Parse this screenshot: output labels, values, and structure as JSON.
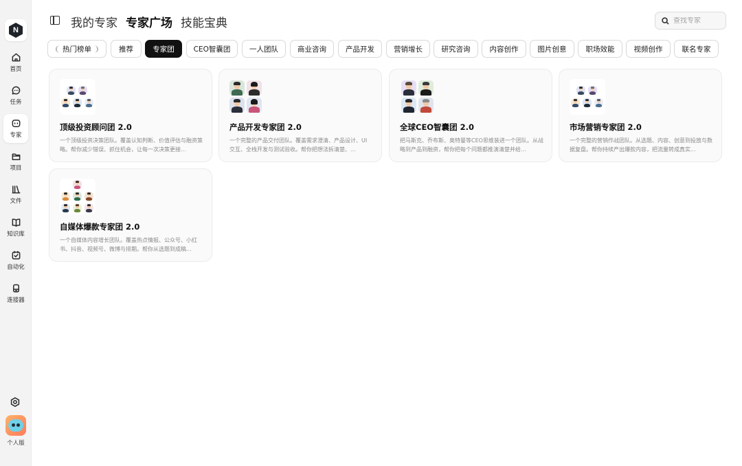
{
  "sidebar": {
    "logo_letter": "N",
    "items": [
      {
        "label": "首页",
        "icon": "home-icon"
      },
      {
        "label": "任务",
        "icon": "chat-icon"
      },
      {
        "label": "专家",
        "icon": "expert-icon",
        "active": true
      },
      {
        "label": "项目",
        "icon": "folder-icon"
      },
      {
        "label": "文件",
        "icon": "library-icon"
      },
      {
        "label": "知识库",
        "icon": "book-icon"
      },
      {
        "label": "自动化",
        "icon": "automation-icon"
      },
      {
        "label": "连接器",
        "icon": "connector-icon"
      }
    ],
    "settings_icon": "settings-icon",
    "plan_label": "个人版"
  },
  "header": {
    "tabs": [
      {
        "label": "我的专家",
        "active": false
      },
      {
        "label": "专家广场",
        "active": true
      },
      {
        "label": "技能宝典",
        "active": false
      }
    ],
    "search_placeholder": "查找专家"
  },
  "filters": [
    {
      "label": "热门榜单",
      "laurel": true
    },
    {
      "label": "推荐"
    },
    {
      "label": "专家团",
      "active": true
    },
    {
      "label": "CEO智囊团"
    },
    {
      "label": "一人团队"
    },
    {
      "label": "商业咨询"
    },
    {
      "label": "产品开发"
    },
    {
      "label": "营销增长"
    },
    {
      "label": "研究咨询"
    },
    {
      "label": "内容创作"
    },
    {
      "label": "图片创意"
    },
    {
      "label": "职场效能"
    },
    {
      "label": "视频创作"
    },
    {
      "label": "联名专家"
    }
  ],
  "cards": [
    {
      "title": "顶级投资顾问团 2.0",
      "desc": "一个顶级投资决策团队。覆盖认知判断、价值评估与融资策略。帮你减少错误、抓住机会，让每一次决策更接..."
    },
    {
      "title": "产品开发专家团 2.0",
      "desc": "一个完整的产品交付团队。覆盖需求澄清、产品设计、UI 交互、全栈开发与测试验收。帮你把想法拆清楚、..."
    },
    {
      "title": "全球CEO智囊团 2.0",
      "desc": "把马斯克、乔布斯、奥特曼等CEO思维装进一个团队。从战略到产品到融资，帮你把每个问题都推演清楚并给..."
    },
    {
      "title": "市场营销专家团 2.0",
      "desc": "一个完整的营销作战团队。从选题、内容、创意到投放与数据复盘。帮你持续产出爆款内容，把流量转成真实..."
    },
    {
      "title": "自媒体爆款专家团 2.0",
      "desc": "一个自媒体内容增长团队。覆盖热点情报、公众号、小红书、抖音、视频号、微博与排期。帮你从选题到成稿..."
    }
  ]
}
